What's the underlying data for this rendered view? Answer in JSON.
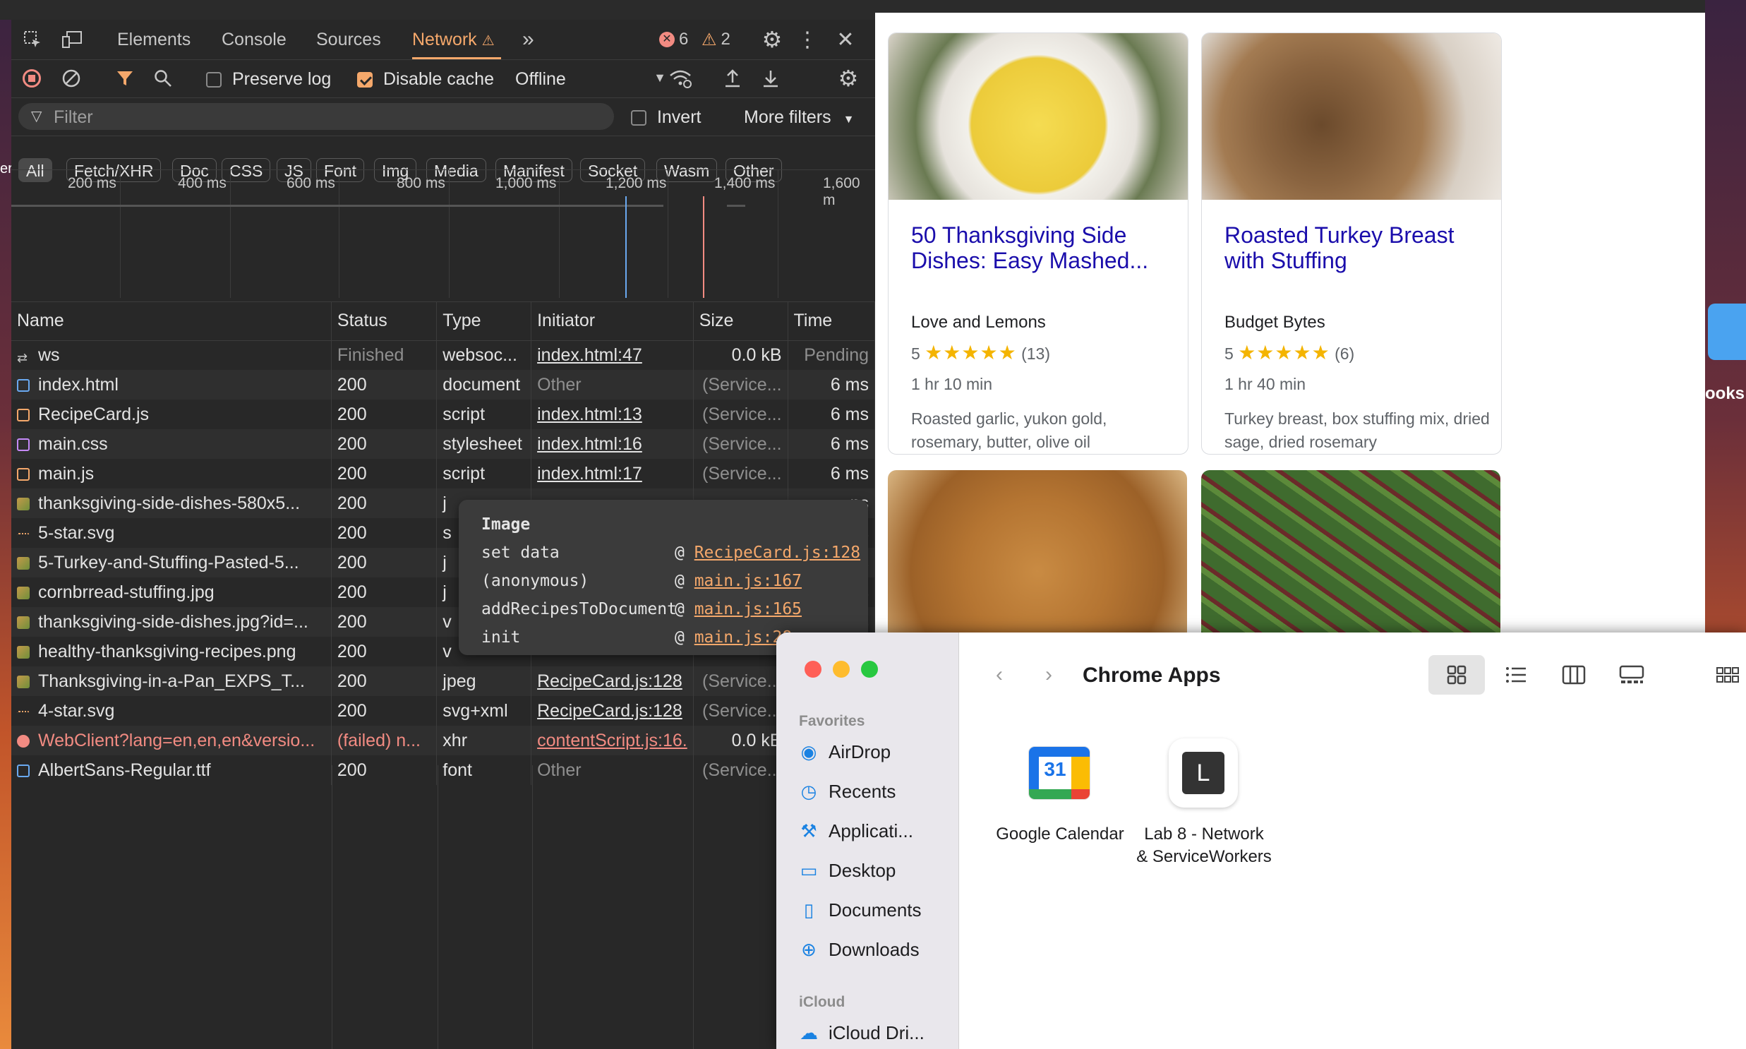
{
  "devtools": {
    "tabs": [
      "Elements",
      "Console",
      "Sources",
      "Network"
    ],
    "active_tab": "Network",
    "more_tabs_icon": "»",
    "errors_count": "6",
    "warnings_count": "2",
    "toolbar": {
      "preserve_log_label": "Preserve log",
      "preserve_log_checked": false,
      "disable_cache_label": "Disable cache",
      "disable_cache_checked": true,
      "throttle_value": "Offline"
    },
    "filter": {
      "placeholder": "Filter",
      "invert_label": "Invert",
      "more_filters_label": "More filters"
    },
    "type_filters": [
      "All",
      "Fetch/XHR",
      "Doc",
      "CSS",
      "JS",
      "Font",
      "Img",
      "Media",
      "Manifest",
      "Socket",
      "Wasm",
      "Other"
    ],
    "timeline_ticks": [
      "200 ms",
      "400 ms",
      "600 ms",
      "800 ms",
      "1,000 ms",
      "1,200 ms",
      "1,400 ms",
      "1,600 m"
    ],
    "columns": [
      "Name",
      "Status",
      "Type",
      "Initiator",
      "Size",
      "Time"
    ],
    "rows": [
      {
        "name": "ws",
        "status": "Finished",
        "type": "websoc...",
        "initiator": "index.html:47",
        "size": "0.0 kB",
        "time": "Pending",
        "icon": "websocket-icon"
      },
      {
        "name": "index.html",
        "status": "200",
        "type": "document",
        "initiator": "Other",
        "size": "(Service...",
        "time": "6 ms",
        "icon": "document-icon"
      },
      {
        "name": "RecipeCard.js",
        "status": "200",
        "type": "script",
        "initiator": "index.html:13",
        "size": "(Service...",
        "time": "6 ms",
        "icon": "script-icon"
      },
      {
        "name": "main.css",
        "status": "200",
        "type": "stylesheet",
        "initiator": "index.html:16",
        "size": "(Service...",
        "time": "6 ms",
        "icon": "stylesheet-icon"
      },
      {
        "name": "main.js",
        "status": "200",
        "type": "script",
        "initiator": "index.html:17",
        "size": "(Service...",
        "time": "6 ms",
        "icon": "script-icon"
      },
      {
        "name": "thanksgiving-side-dishes-580x5...",
        "status": "200",
        "type": "j",
        "initiator": "",
        "size": "",
        "time": "ns",
        "icon": "image-icon"
      },
      {
        "name": "5-star.svg",
        "status": "200",
        "type": "s",
        "initiator": "",
        "size": "",
        "time": "ns",
        "icon": "svg-icon"
      },
      {
        "name": "5-Turkey-and-Stuffing-Pasted-5...",
        "status": "200",
        "type": "j",
        "initiator": "",
        "size": "",
        "time": "ns",
        "icon": "image-icon"
      },
      {
        "name": "cornbrread-stuffing.jpg",
        "status": "200",
        "type": "j",
        "initiator": "",
        "size": "",
        "time": "ns",
        "icon": "image-icon"
      },
      {
        "name": "thanksgiving-side-dishes.jpg?id=...",
        "status": "200",
        "type": "v",
        "initiator": "",
        "size": "",
        "time": "ns",
        "icon": "image-icon"
      },
      {
        "name": "healthy-thanksgiving-recipes.png",
        "status": "200",
        "type": "v",
        "initiator": "",
        "size": "",
        "time": "ns",
        "icon": "image-icon"
      },
      {
        "name": "Thanksgiving-in-a-Pan_EXPS_T...",
        "status": "200",
        "type": "jpeg",
        "initiator": "RecipeCard.js:128",
        "size": "(Service...",
        "time": "",
        "icon": "image-icon"
      },
      {
        "name": "4-star.svg",
        "status": "200",
        "type": "svg+xml",
        "initiator": "RecipeCard.js:128",
        "size": "(Service...",
        "time": "",
        "icon": "svg-icon"
      },
      {
        "name": "WebClient?lang=en,en,en&versio...",
        "status": "(failed) n...",
        "type": "xhr",
        "initiator": "contentScript.js:16.",
        "size": "0.0 kE",
        "time": "",
        "icon": "error-icon",
        "failed": true
      },
      {
        "name": "AlbertSans-Regular.ttf",
        "status": "200",
        "type": "font",
        "initiator": "Other",
        "size": "(Service...",
        "time": "",
        "icon": "font-icon"
      }
    ],
    "tooltip": {
      "title": "Image",
      "frames": [
        {
          "fn": "set data",
          "loc": "RecipeCard.js:128"
        },
        {
          "fn": "(anonymous)",
          "loc": "main.js:167"
        },
        {
          "fn": "addRecipesToDocument",
          "loc": "main.js:165"
        },
        {
          "fn": "init",
          "loc": "main.js:28"
        }
      ]
    }
  },
  "webpage": {
    "cards": [
      {
        "title": "50 Thanksgiving Side Dishes: Easy Mashed...",
        "source": "Love and Lemons",
        "rating": "5",
        "stars": "★★★★★",
        "count": "(13)",
        "time": "1 hr 10 min",
        "ingredients": "Roasted garlic, yukon gold, rosemary, butter, olive oil"
      },
      {
        "title": "Roasted Turkey Breast with Stuffing",
        "source": "Budget Bytes",
        "rating": "5",
        "stars": "★★★★★",
        "count": "(6)",
        "time": "1 hr 40 min",
        "ingredients": "Turkey breast, box stuffing mix, dried sage, dried rosemary"
      }
    ]
  },
  "finder": {
    "title": "Chrome Apps",
    "sidebar": {
      "favorites_header": "Favorites",
      "favorites": [
        "AirDrop",
        "Recents",
        "Applicati...",
        "Desktop",
        "Documents",
        "Downloads"
      ],
      "icloud_header": "iCloud",
      "icloud": [
        "iCloud Dri..."
      ]
    },
    "apps": [
      {
        "label": "Google Calendar",
        "glyph": "31"
      },
      {
        "label_line1": "Lab 8 - Network",
        "label_line2": "& ServiceWorkers",
        "glyph": "L"
      }
    ]
  },
  "desktop": {
    "partial_label": "ooks",
    "partial_left_label": "er"
  }
}
